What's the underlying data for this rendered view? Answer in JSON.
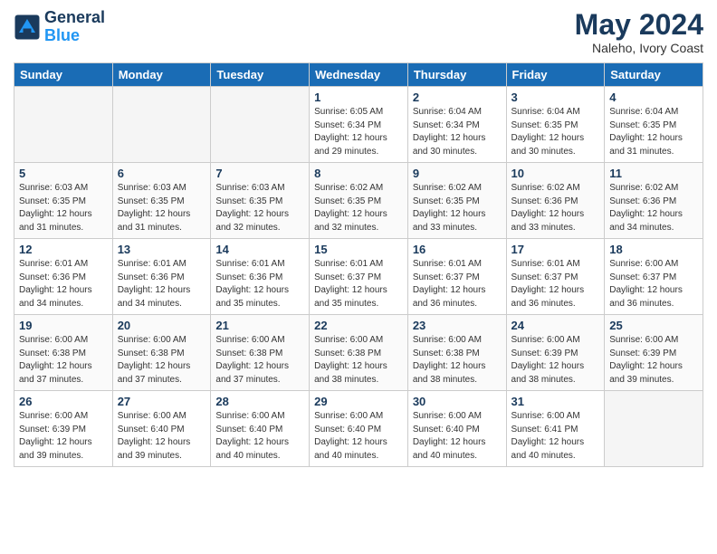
{
  "logo": {
    "line1": "General",
    "line2": "Blue"
  },
  "title": {
    "month_year": "May 2024",
    "location": "Naleho, Ivory Coast"
  },
  "days_of_week": [
    "Sunday",
    "Monday",
    "Tuesday",
    "Wednesday",
    "Thursday",
    "Friday",
    "Saturday"
  ],
  "weeks": [
    [
      {
        "day": "",
        "info": ""
      },
      {
        "day": "",
        "info": ""
      },
      {
        "day": "",
        "info": ""
      },
      {
        "day": "1",
        "info": "Sunrise: 6:05 AM\nSunset: 6:34 PM\nDaylight: 12 hours\nand 29 minutes."
      },
      {
        "day": "2",
        "info": "Sunrise: 6:04 AM\nSunset: 6:34 PM\nDaylight: 12 hours\nand 30 minutes."
      },
      {
        "day": "3",
        "info": "Sunrise: 6:04 AM\nSunset: 6:35 PM\nDaylight: 12 hours\nand 30 minutes."
      },
      {
        "day": "4",
        "info": "Sunrise: 6:04 AM\nSunset: 6:35 PM\nDaylight: 12 hours\nand 31 minutes."
      }
    ],
    [
      {
        "day": "5",
        "info": "Sunrise: 6:03 AM\nSunset: 6:35 PM\nDaylight: 12 hours\nand 31 minutes."
      },
      {
        "day": "6",
        "info": "Sunrise: 6:03 AM\nSunset: 6:35 PM\nDaylight: 12 hours\nand 31 minutes."
      },
      {
        "day": "7",
        "info": "Sunrise: 6:03 AM\nSunset: 6:35 PM\nDaylight: 12 hours\nand 32 minutes."
      },
      {
        "day": "8",
        "info": "Sunrise: 6:02 AM\nSunset: 6:35 PM\nDaylight: 12 hours\nand 32 minutes."
      },
      {
        "day": "9",
        "info": "Sunrise: 6:02 AM\nSunset: 6:35 PM\nDaylight: 12 hours\nand 33 minutes."
      },
      {
        "day": "10",
        "info": "Sunrise: 6:02 AM\nSunset: 6:36 PM\nDaylight: 12 hours\nand 33 minutes."
      },
      {
        "day": "11",
        "info": "Sunrise: 6:02 AM\nSunset: 6:36 PM\nDaylight: 12 hours\nand 34 minutes."
      }
    ],
    [
      {
        "day": "12",
        "info": "Sunrise: 6:01 AM\nSunset: 6:36 PM\nDaylight: 12 hours\nand 34 minutes."
      },
      {
        "day": "13",
        "info": "Sunrise: 6:01 AM\nSunset: 6:36 PM\nDaylight: 12 hours\nand 34 minutes."
      },
      {
        "day": "14",
        "info": "Sunrise: 6:01 AM\nSunset: 6:36 PM\nDaylight: 12 hours\nand 35 minutes."
      },
      {
        "day": "15",
        "info": "Sunrise: 6:01 AM\nSunset: 6:37 PM\nDaylight: 12 hours\nand 35 minutes."
      },
      {
        "day": "16",
        "info": "Sunrise: 6:01 AM\nSunset: 6:37 PM\nDaylight: 12 hours\nand 36 minutes."
      },
      {
        "day": "17",
        "info": "Sunrise: 6:01 AM\nSunset: 6:37 PM\nDaylight: 12 hours\nand 36 minutes."
      },
      {
        "day": "18",
        "info": "Sunrise: 6:00 AM\nSunset: 6:37 PM\nDaylight: 12 hours\nand 36 minutes."
      }
    ],
    [
      {
        "day": "19",
        "info": "Sunrise: 6:00 AM\nSunset: 6:38 PM\nDaylight: 12 hours\nand 37 minutes."
      },
      {
        "day": "20",
        "info": "Sunrise: 6:00 AM\nSunset: 6:38 PM\nDaylight: 12 hours\nand 37 minutes."
      },
      {
        "day": "21",
        "info": "Sunrise: 6:00 AM\nSunset: 6:38 PM\nDaylight: 12 hours\nand 37 minutes."
      },
      {
        "day": "22",
        "info": "Sunrise: 6:00 AM\nSunset: 6:38 PM\nDaylight: 12 hours\nand 38 minutes."
      },
      {
        "day": "23",
        "info": "Sunrise: 6:00 AM\nSunset: 6:38 PM\nDaylight: 12 hours\nand 38 minutes."
      },
      {
        "day": "24",
        "info": "Sunrise: 6:00 AM\nSunset: 6:39 PM\nDaylight: 12 hours\nand 38 minutes."
      },
      {
        "day": "25",
        "info": "Sunrise: 6:00 AM\nSunset: 6:39 PM\nDaylight: 12 hours\nand 39 minutes."
      }
    ],
    [
      {
        "day": "26",
        "info": "Sunrise: 6:00 AM\nSunset: 6:39 PM\nDaylight: 12 hours\nand 39 minutes."
      },
      {
        "day": "27",
        "info": "Sunrise: 6:00 AM\nSunset: 6:40 PM\nDaylight: 12 hours\nand 39 minutes."
      },
      {
        "day": "28",
        "info": "Sunrise: 6:00 AM\nSunset: 6:40 PM\nDaylight: 12 hours\nand 40 minutes."
      },
      {
        "day": "29",
        "info": "Sunrise: 6:00 AM\nSunset: 6:40 PM\nDaylight: 12 hours\nand 40 minutes."
      },
      {
        "day": "30",
        "info": "Sunrise: 6:00 AM\nSunset: 6:40 PM\nDaylight: 12 hours\nand 40 minutes."
      },
      {
        "day": "31",
        "info": "Sunrise: 6:00 AM\nSunset: 6:41 PM\nDaylight: 12 hours\nand 40 minutes."
      },
      {
        "day": "",
        "info": ""
      }
    ]
  ]
}
